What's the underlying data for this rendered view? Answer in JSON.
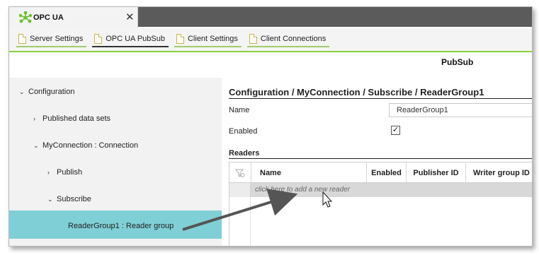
{
  "app": {
    "tab_title": "OPC UA",
    "close_glyph": "✕",
    "logo_icon": "opcua-logo-icon"
  },
  "subnav": [
    {
      "label": "Server Settings"
    },
    {
      "label": "OPC UA PubSub"
    },
    {
      "label": "Client Settings"
    },
    {
      "label": "Client Connections"
    }
  ],
  "page_title": "PubSub",
  "tree": {
    "configuration": "Configuration",
    "published": "Published data sets",
    "myconnection": "MyConnection : Connection",
    "publish": "Publish",
    "subscribe": "Subscribe",
    "readergroup": "ReaderGroup1 : Reader group"
  },
  "main": {
    "breadcrumb": "Configuration / MyConnection / Subscribe / ReaderGroup1",
    "name_label": "Name",
    "name_value": "ReaderGroup1",
    "enabled_label": "Enabled",
    "enabled_check": "✓",
    "readers_label": "Readers"
  },
  "table": {
    "headers": {
      "name": "Name",
      "enabled": "Enabled",
      "publisher": "Publisher ID",
      "writergroup": "Writer group ID"
    },
    "add_row": "click here to add a new reader"
  },
  "colors": {
    "accent_green": "#8ccf3f",
    "selection": "#7fcfd6"
  }
}
